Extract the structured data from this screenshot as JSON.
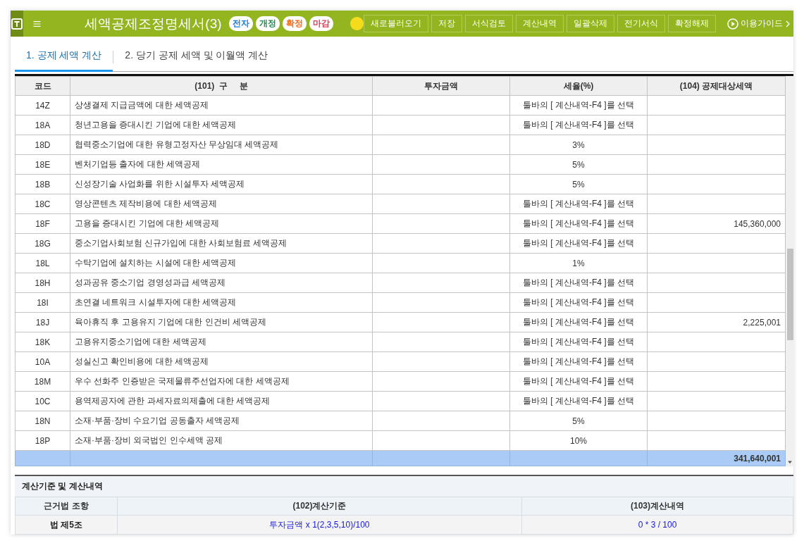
{
  "header": {
    "title": "세액공제조정명세서(3)",
    "badges": [
      {
        "label": "전자",
        "color": "#1a7fe0"
      },
      {
        "label": "개정",
        "color": "#1b8a4a"
      },
      {
        "label": "확정",
        "color": "#f06a10"
      },
      {
        "label": "마감",
        "color": "#e8364f"
      }
    ],
    "toolbar": [
      "새로불러오기",
      "저장",
      "서식검토",
      "계산내역",
      "일괄삭제",
      "전기서식",
      "확정해제"
    ],
    "guide": "이용가이드"
  },
  "tabs": [
    {
      "label": "1. 공제 세액 계산",
      "selected": true
    },
    {
      "label": "2. 당기 공제 세액 및 이월액 계산",
      "selected": false
    }
  ],
  "table": {
    "columns": [
      "코드",
      "(101)  구     분",
      "투자금액",
      "세율(%)",
      "(104) 공제대상세액"
    ],
    "rows": [
      {
        "code": "14Z",
        "name": "상생결제 지급금액에 대한 세액공제",
        "rate": "툴바의 [ 계산내역-F4 ]를 선택"
      },
      {
        "code": "18A",
        "name": "청년고용을 증대시킨 기업에 대한 세액공제",
        "rate": "툴바의 [ 계산내역-F4 ]를 선택"
      },
      {
        "code": "18D",
        "name": "협력중소기업에 대한 유형고정자산 무상임대 세액공제",
        "rate": "3%"
      },
      {
        "code": "18E",
        "name": "벤처기업등 출자에 대한 세액공제",
        "rate": "5%"
      },
      {
        "code": "18B",
        "name": "신성장기술 사업화를 위한 시설투자 세액공제",
        "rate": "5%"
      },
      {
        "code": "18C",
        "name": "영상콘텐츠 제작비용에 대한 세액공제",
        "rate": "툴바의 [ 계산내역-F4 ]를 선택"
      },
      {
        "code": "18F",
        "name": "고용을 증대시킨 기업에 대한 세액공제",
        "rate": "툴바의 [ 계산내역-F4 ]를 선택",
        "deduction": "145,360,000"
      },
      {
        "code": "18G",
        "name": "중소기업사회보험 신규가입에 대한 사회보험료 세액공제",
        "rate": "툴바의 [ 계산내역-F4 ]를 선택"
      },
      {
        "code": "18L",
        "name": "수탁기업에 설치하는 시설에 대한 세액공제",
        "rate": "1%"
      },
      {
        "code": "18H",
        "name": "성과공유 중소기업 경영성과급 세액공제",
        "rate": "툴바의 [ 계산내역-F4 ]를 선택"
      },
      {
        "code": "18I",
        "name": "초연결 네트워크 시설투자에 대한 세액공제",
        "rate": "툴바의 [ 계산내역-F4 ]를 선택"
      },
      {
        "code": "18J",
        "name": "육아휴직 후 고용유지 기업에 대한 인건비 세액공제",
        "rate": "툴바의 [ 계산내역-F4 ]를 선택",
        "deduction": "2,225,001"
      },
      {
        "code": "18K",
        "name": "고용유지중소기업에 대한 세액공제",
        "rate": "툴바의 [ 계산내역-F4 ]를 선택"
      },
      {
        "code": "10A",
        "name": "성실신고 확인비용에 대한 세액공제",
        "rate": "툴바의 [ 계산내역-F4 ]를 선택"
      },
      {
        "code": "18M",
        "name": "우수 선화주 인증받은 국제물류주선업자에 대한 세액공제",
        "rate": "툴바의 [ 계산내역-F4 ]를 선택"
      },
      {
        "code": "10C",
        "name": "용역제공자에 관한 과세자료의제출에 대한 세액공제",
        "rate": "툴바의 [ 계산내역-F4 ]를 선택"
      },
      {
        "code": "18N",
        "name": "소재·부품·장비 수요기업 공동출자 세액공제",
        "rate": "5%"
      },
      {
        "code": "18P",
        "name": "소재·부품·장비 외국법인 인수세액 공제",
        "rate": "10%"
      }
    ],
    "total": {
      "deduction": "341,640,001"
    }
  },
  "calc": {
    "title": "계산기준 및 계산내역",
    "columns": [
      "근거법 조항",
      "(102)계산기준",
      "(103)계산내역"
    ],
    "rows": [
      {
        "article": "법 제5조",
        "basis": "투자금액 x 1(2,3,5,10)/100",
        "detail": "0 * 3 / 100"
      }
    ]
  }
}
